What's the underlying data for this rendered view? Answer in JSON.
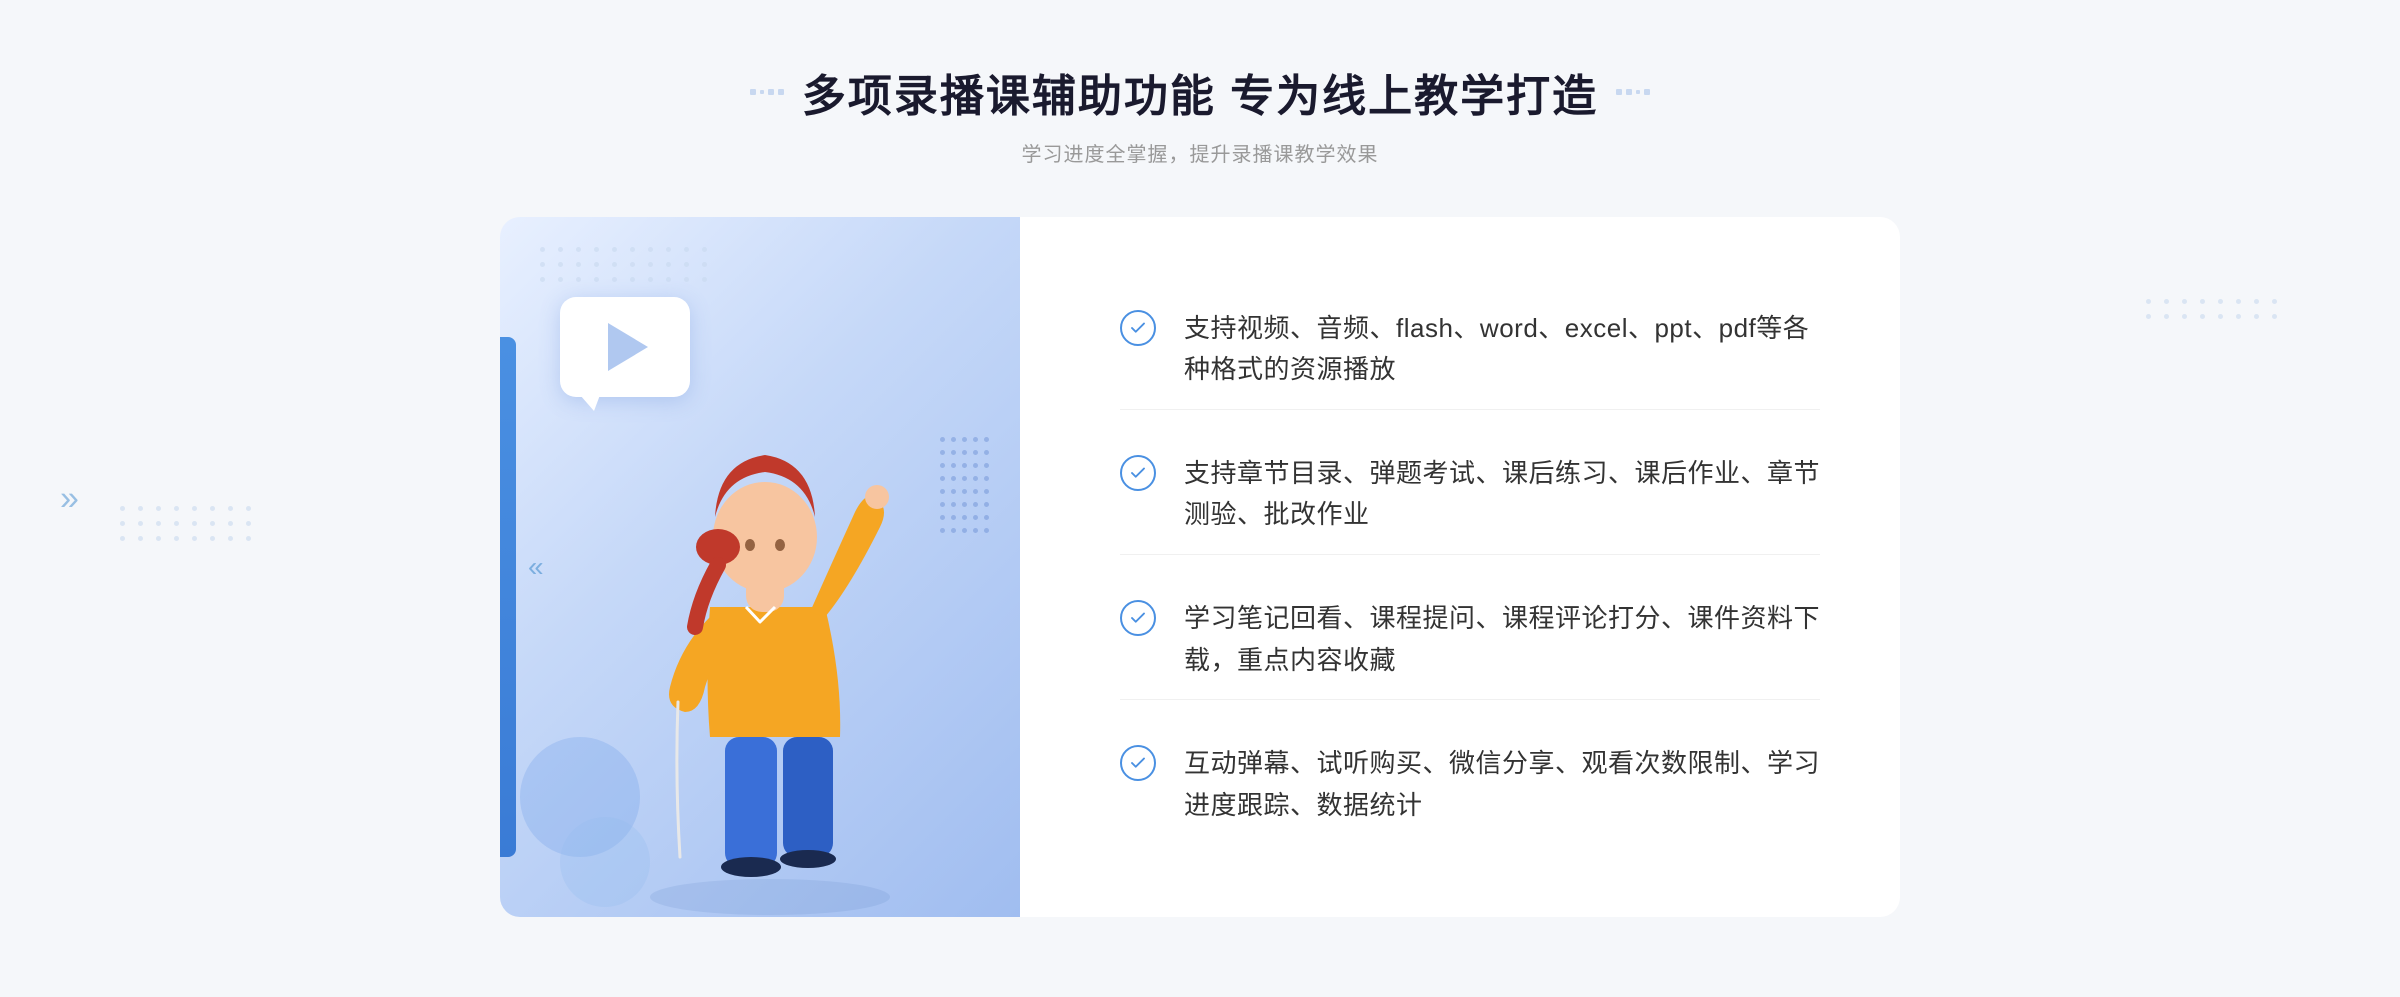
{
  "page": {
    "background_color": "#f5f7fa"
  },
  "header": {
    "title": "多项录播课辅助功能 专为线上教学打造",
    "subtitle": "学习进度全掌握，提升录播课教学效果",
    "decoration_left": "❖",
    "decoration_right": "❖"
  },
  "features": [
    {
      "id": 1,
      "text": "支持视频、音频、flash、word、excel、ppt、pdf等各种格式的资源播放"
    },
    {
      "id": 2,
      "text": "支持章节目录、弹题考试、课后练习、课后作业、章节测验、批改作业"
    },
    {
      "id": 3,
      "text": "学习笔记回看、课程提问、课程评论打分、课件资料下载，重点内容收藏"
    },
    {
      "id": 4,
      "text": "互动弹幕、试听购买、微信分享、观看次数限制、学习进度跟踪、数据统计"
    }
  ],
  "illustration": {
    "play_icon": "▶",
    "arrows_left": "»"
  },
  "colors": {
    "primary_blue": "#4a90e2",
    "light_blue": "#6ab0f5",
    "text_dark": "#1a1a2e",
    "text_gray": "#999999",
    "text_body": "#333333",
    "check_color": "#4a90e2",
    "panel_bg": "#ffffff",
    "left_panel_gradient_start": "#ddeaff",
    "left_panel_gradient_end": "#aac8f0"
  }
}
